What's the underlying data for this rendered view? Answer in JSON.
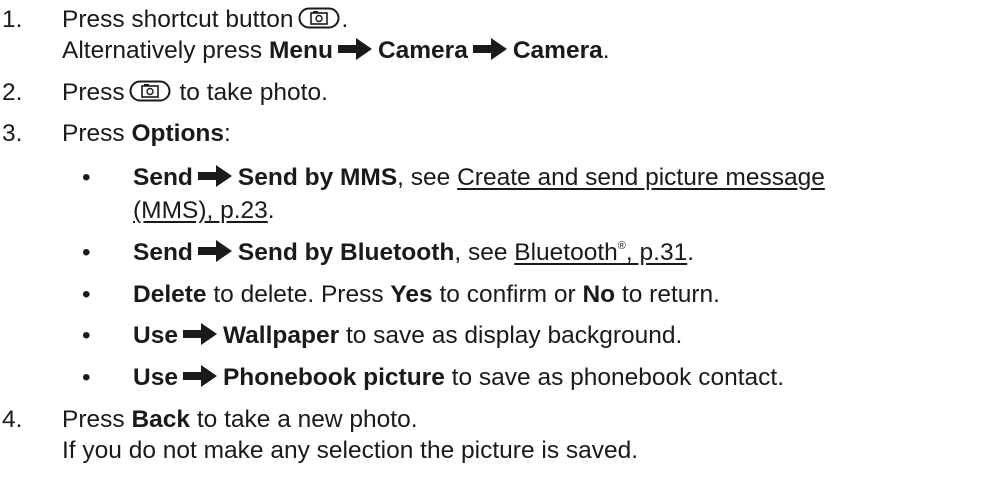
{
  "steps": [
    {
      "number": "1.",
      "line1_pre": "Press shortcut button",
      "line1_icon": "camera-key-icon",
      "line1_post": ".",
      "line2_pre": "Alternatively press",
      "path": [
        "Menu",
        "Camera",
        "Camera"
      ],
      "line2_post": "."
    },
    {
      "number": "2.",
      "pre": "Press",
      "icon": "camera-key-icon",
      "post": "to take photo."
    },
    {
      "number": "3.",
      "pre": "Press",
      "bold": "Options",
      "post": ":",
      "bullets": [
        {
          "bullet": "•",
          "b1": "Send",
          "b2": "Send by MMS",
          "mid": ", see",
          "link_line1": "Create and send picture message",
          "link_line2": "(MMS), p.23",
          "end": "."
        },
        {
          "bullet": "•",
          "b1": "Send",
          "b2": "Send by Bluetooth",
          "mid": ", see",
          "link": "Bluetooth",
          "link_sup": "®",
          "link_tail": ", p.31",
          "end": "."
        },
        {
          "bullet": "•",
          "b1": "Delete",
          "t1": "to delete. Press",
          "b2": "Yes",
          "t2": "to confirm or",
          "b3": "No",
          "t3": "to return."
        },
        {
          "bullet": "•",
          "b1": "Use",
          "b2": "Wallpaper",
          "t": "to save as display background."
        },
        {
          "bullet": "•",
          "b1": "Use",
          "b2": "Phonebook picture",
          "t": "to save as phonebook contact."
        }
      ]
    },
    {
      "number": "4.",
      "pre": "Press",
      "bold": "Back",
      "post": "to take a new photo.",
      "line2": "If you do not make any selection the picture is saved."
    }
  ],
  "icons": {
    "arrow": "right-arrow-icon",
    "camera_key": "camera-key-icon"
  },
  "colors": {
    "text": "#1a1a1a",
    "background": "#ffffff"
  }
}
